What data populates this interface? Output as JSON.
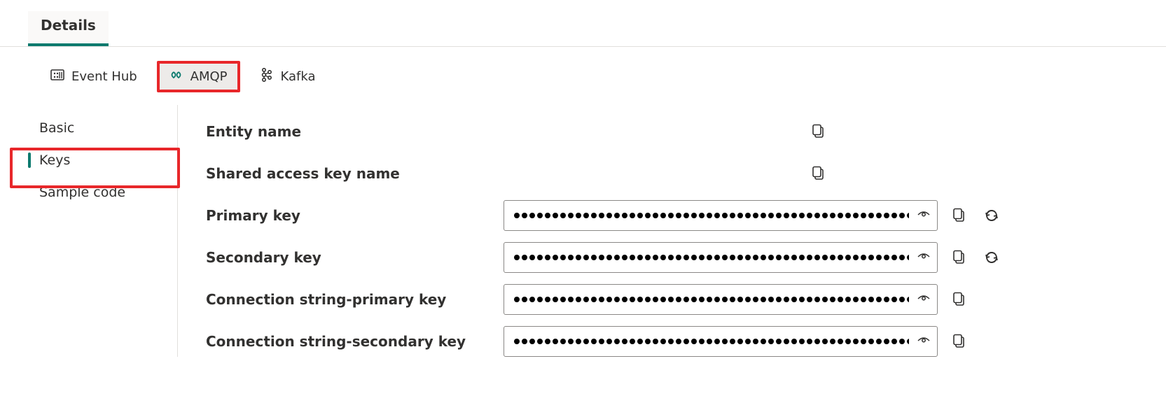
{
  "topTabs": {
    "details": "Details"
  },
  "protocols": {
    "eventhub": "Event Hub",
    "amqp": "AMQP",
    "kafka": "Kafka"
  },
  "sideNav": {
    "basic": "Basic",
    "keys": "Keys",
    "sampleCode": "Sample code"
  },
  "fields": {
    "entityName": "Entity name",
    "sharedAccessKeyName": "Shared access key name",
    "primaryKey": "Primary key",
    "secondaryKey": "Secondary key",
    "connPrimary": "Connection string-primary key",
    "connSecondary": "Connection string-secondary key"
  }
}
